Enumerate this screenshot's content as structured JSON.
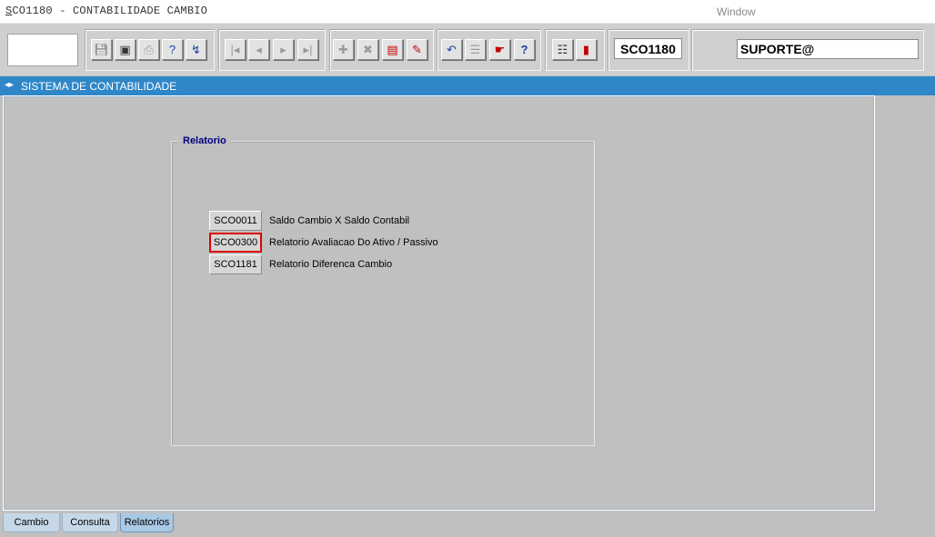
{
  "window": {
    "title_first_char": "S",
    "title_rest": "CO1180 - CONTABILIDADE CAMBIO",
    "menu_window": "Window"
  },
  "toolbar": {
    "buttons": [
      {
        "name": "save",
        "icon": "floppy-disk-icon"
      },
      {
        "name": "screen",
        "icon": "monitor-icon"
      },
      {
        "name": "print",
        "icon": "printer-icon"
      },
      {
        "name": "query",
        "icon": "query-help-icon"
      },
      {
        "name": "execute",
        "icon": "lightning-icon"
      },
      {
        "name": "first",
        "icon": "first-record-icon"
      },
      {
        "name": "previous",
        "icon": "previous-record-icon"
      },
      {
        "name": "next",
        "icon": "next-record-icon"
      },
      {
        "name": "last",
        "icon": "last-record-icon"
      },
      {
        "name": "insert",
        "icon": "plus-icon"
      },
      {
        "name": "delete",
        "icon": "x-icon"
      },
      {
        "name": "clear",
        "icon": "clear-form-icon"
      },
      {
        "name": "edit",
        "icon": "pencil-icon"
      },
      {
        "name": "undo",
        "icon": "undo-icon"
      },
      {
        "name": "list",
        "icon": "clipboard-icon"
      },
      {
        "name": "help-user",
        "icon": "user-help-icon"
      },
      {
        "name": "help",
        "icon": "question-mark-icon"
      },
      {
        "name": "menu",
        "icon": "menu-icon"
      },
      {
        "name": "exit",
        "icon": "exit-door-icon"
      }
    ],
    "form_code": "SCO1180",
    "user": "SUPORTE@"
  },
  "header": {
    "title": "SISTEMA DE CONTABILIDADE"
  },
  "frame": {
    "title": "Relatorio",
    "reports": [
      {
        "code": "SCO0011",
        "label": "Saldo Cambio X Saldo Contabil"
      },
      {
        "code": "SCO0300",
        "label": "Relatorio Avaliacao Do Ativo / Passivo"
      },
      {
        "code": "SCO1181",
        "label": "Relatorio Diferenca Cambio"
      }
    ]
  },
  "tabs": [
    {
      "label": "Cambio"
    },
    {
      "label": "Consulta"
    },
    {
      "label": "Relatorios"
    }
  ],
  "colors": {
    "header_blue": "#2f87c8",
    "selection_red": "#e00000",
    "frame_title": "#000080"
  }
}
